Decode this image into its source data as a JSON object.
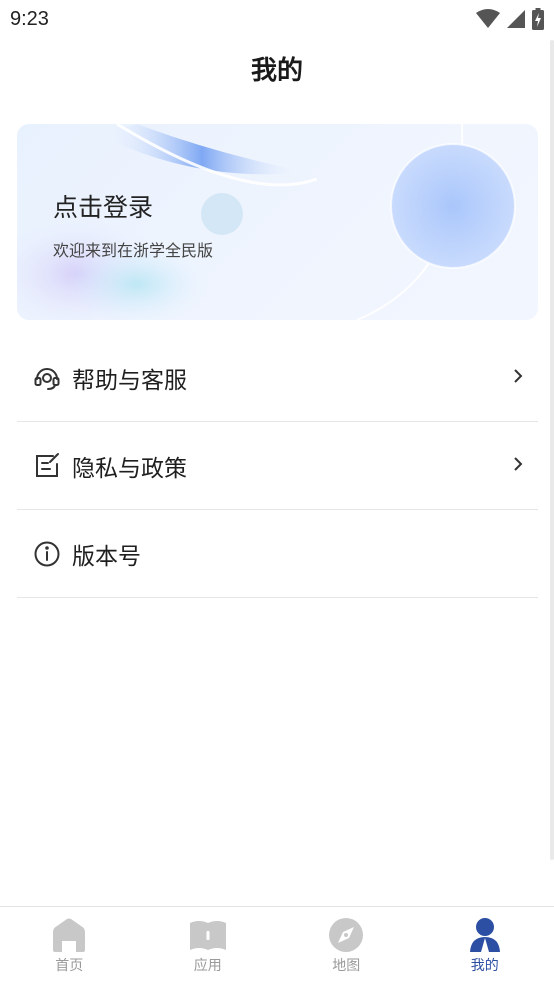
{
  "status_bar": {
    "time": "9:23",
    "icons": [
      "wifi-icon",
      "cellular-signal-icon",
      "battery-charging-icon"
    ]
  },
  "header": {
    "title": "我的"
  },
  "login_card": {
    "title": "点击登录",
    "subtitle": "欢迎来到在浙学全民版"
  },
  "menu": {
    "items": [
      {
        "label": "帮助与客服",
        "icon": "headset-icon",
        "has_chevron": true
      },
      {
        "label": "隐私与政策",
        "icon": "edit-document-icon",
        "has_chevron": true
      },
      {
        "label": "版本号",
        "icon": "info-icon",
        "has_chevron": false
      }
    ]
  },
  "tab_bar": {
    "tabs": [
      {
        "label": "首页",
        "icon": "home-icon",
        "active": false
      },
      {
        "label": "应用",
        "icon": "book-icon",
        "active": false
      },
      {
        "label": "地图",
        "icon": "compass-icon",
        "active": false
      },
      {
        "label": "我的",
        "icon": "user-icon",
        "active": true
      }
    ],
    "active_color": "#2c4fa3",
    "inactive_color": "#c8c8c8"
  }
}
